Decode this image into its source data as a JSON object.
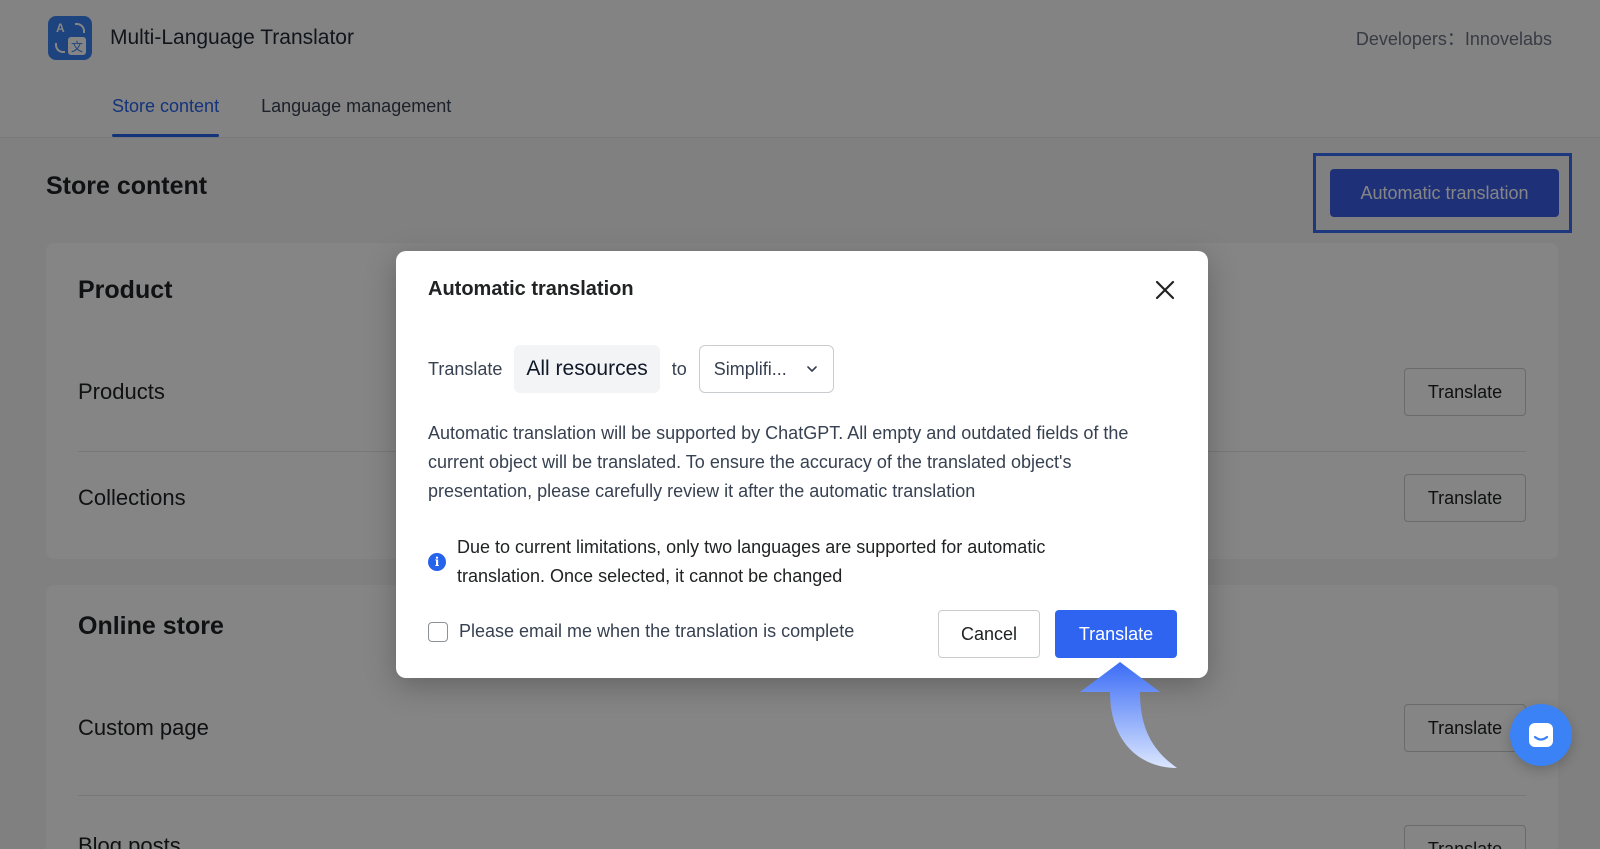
{
  "header": {
    "title": "Multi-Language Translator",
    "developers": "Developers：Innovelabs",
    "logo_icon": "translate-icon"
  },
  "tabs": [
    {
      "label": "Store content",
      "active": true
    },
    {
      "label": "Language management",
      "active": false
    }
  ],
  "page": {
    "title": "Store content",
    "automatic_translation_label": "Automatic translation"
  },
  "sections": [
    {
      "title": "Product",
      "rows": [
        {
          "label": "Products",
          "button": "Translate"
        },
        {
          "label": "Collections",
          "button": "Translate"
        }
      ]
    },
    {
      "title": "Online store",
      "rows": [
        {
          "label": "Custom page",
          "button": "Translate"
        },
        {
          "label": "Blog posts",
          "button": "Translate"
        }
      ]
    }
  ],
  "modal": {
    "title": "Automatic translation",
    "translate_word": "Translate",
    "resource_value": "All resources",
    "to_word": "to",
    "language_value": "Simplifi...",
    "description": "Automatic translation will be supported by ChatGPT. All empty and outdated fields of the current object will be translated. To ensure the accuracy of the translated object's presentation, please carefully review it after the automatic translation",
    "notice": "Due to current limitations, only two languages are supported for automatic translation. Once selected, it cannot be changed",
    "email_label": "Please email me when the translation is complete",
    "email_checked": false,
    "cancel_label": "Cancel",
    "confirm_label": "Translate"
  },
  "colors": {
    "primary": "#2e64f0",
    "highlight_outline": "#3b6cf6",
    "overlay": "rgba(0,0,0,0.48)"
  }
}
